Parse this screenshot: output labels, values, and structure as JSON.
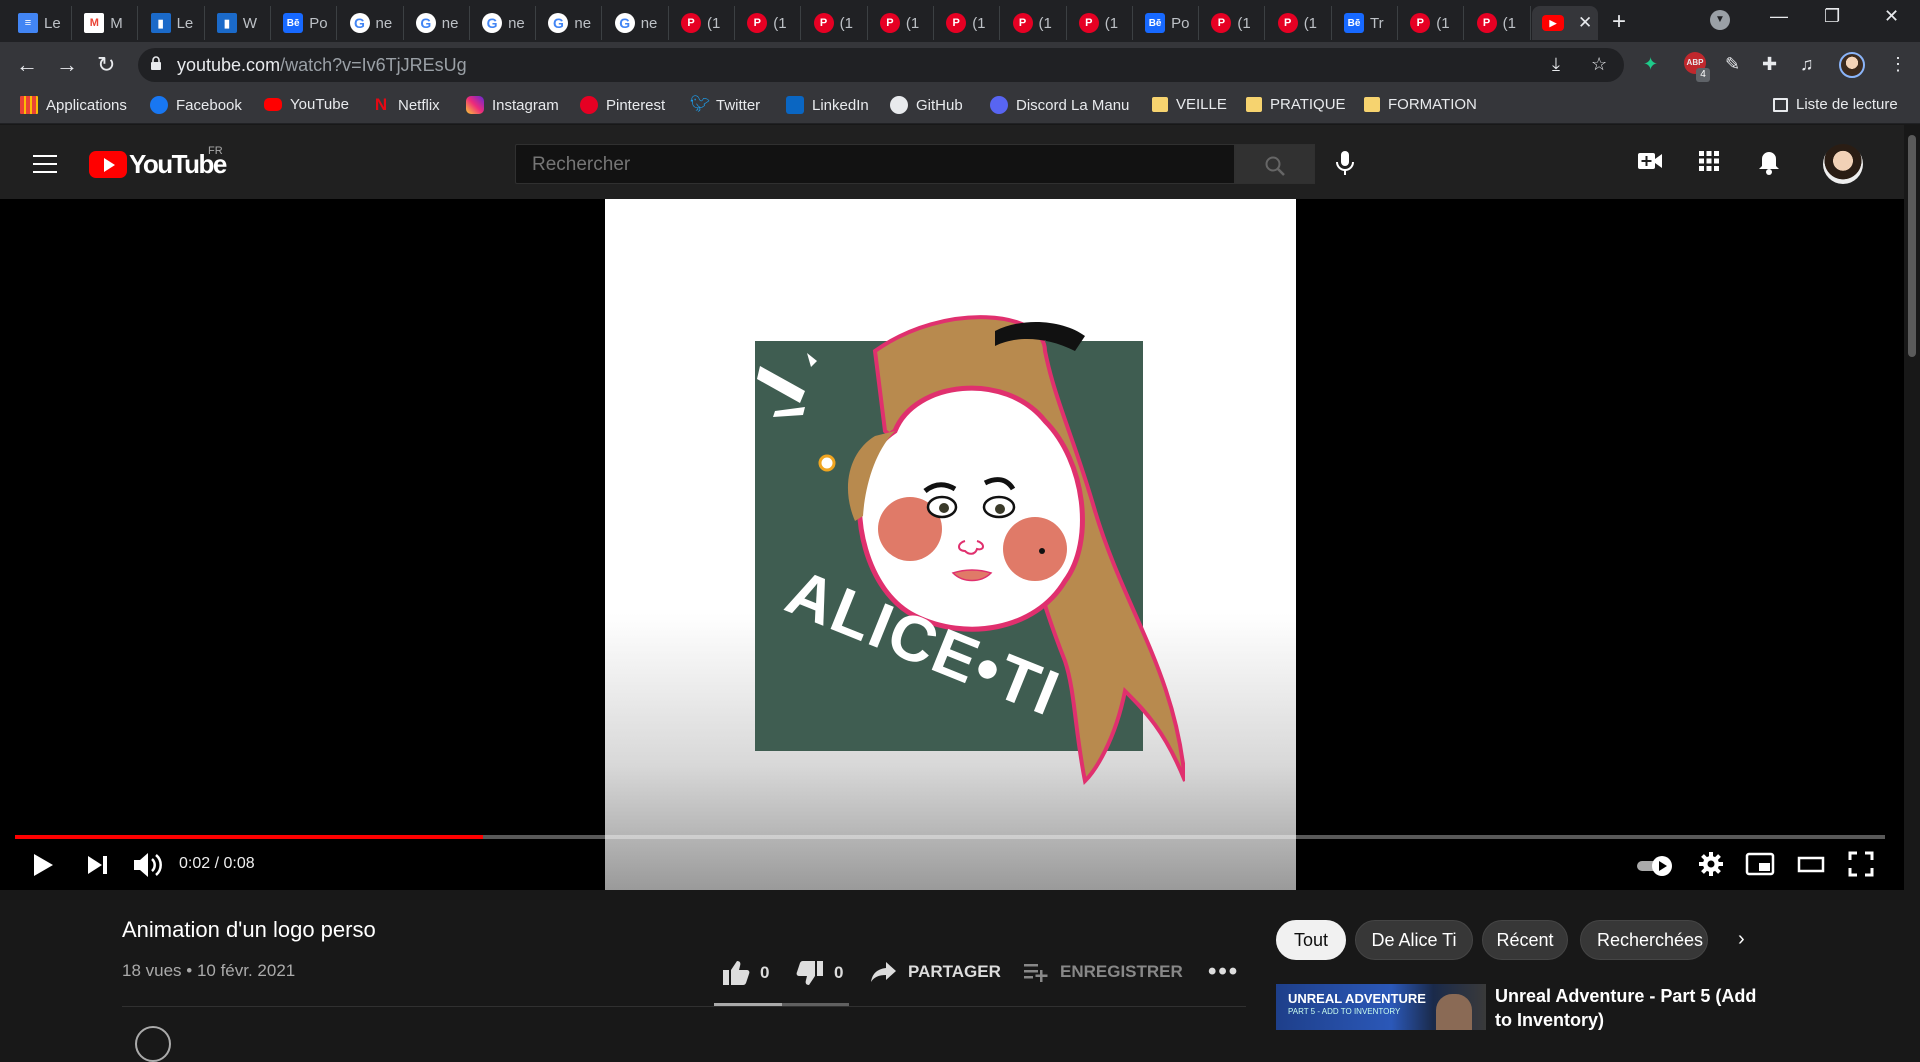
{
  "browser": {
    "tabs": [
      {
        "label": "Le",
        "icon": "docs-icon",
        "kind": "doc"
      },
      {
        "label": "M",
        "icon": "gmail-icon",
        "kind": "mail"
      },
      {
        "label": "Le",
        "icon": "webflow-icon",
        "kind": "wv"
      },
      {
        "label": "W",
        "icon": "webflow-icon",
        "kind": "wv"
      },
      {
        "label": "Po",
        "icon": "behance-icon",
        "kind": "be"
      },
      {
        "label": "ne",
        "icon": "google-icon",
        "kind": "g"
      },
      {
        "label": "ne",
        "icon": "google-icon",
        "kind": "g"
      },
      {
        "label": "ne",
        "icon": "google-icon",
        "kind": "g"
      },
      {
        "label": "ne",
        "icon": "google-icon",
        "kind": "g"
      },
      {
        "label": "ne",
        "icon": "google-icon",
        "kind": "g"
      },
      {
        "label": "(1",
        "icon": "pinterest-icon",
        "kind": "p"
      },
      {
        "label": "(1",
        "icon": "pinterest-icon",
        "kind": "p"
      },
      {
        "label": "(1",
        "icon": "pinterest-icon",
        "kind": "p"
      },
      {
        "label": "(1",
        "icon": "pinterest-icon",
        "kind": "p"
      },
      {
        "label": "(1",
        "icon": "pinterest-icon",
        "kind": "p"
      },
      {
        "label": "(1",
        "icon": "pinterest-icon",
        "kind": "p"
      },
      {
        "label": "(1",
        "icon": "pinterest-icon",
        "kind": "p"
      },
      {
        "label": "Po",
        "icon": "behance-icon",
        "kind": "be"
      },
      {
        "label": "(1",
        "icon": "pinterest-icon",
        "kind": "p"
      },
      {
        "label": "(1",
        "icon": "pinterest-icon",
        "kind": "p"
      },
      {
        "label": "Tr",
        "icon": "behance-icon",
        "kind": "be"
      },
      {
        "label": "(1",
        "icon": "pinterest-icon",
        "kind": "p"
      },
      {
        "label": "(1",
        "icon": "pinterest-icon",
        "kind": "p"
      }
    ],
    "active_tab_icon": "youtube-icon",
    "url_host": "youtube.com",
    "url_path": "/watch?v=Iv6TjJREsUg",
    "extension_badge": "4",
    "bookmarks": [
      {
        "label": "Applications",
        "icon": "apps-grid-icon",
        "cls": "grid"
      },
      {
        "label": "Facebook",
        "icon": "facebook-icon",
        "cls": "fb"
      },
      {
        "label": "YouTube",
        "icon": "youtube-icon",
        "cls": "ytb"
      },
      {
        "label": "Netflix",
        "icon": "netflix-icon",
        "cls": "nf"
      },
      {
        "label": "Instagram",
        "icon": "instagram-icon",
        "cls": "ig"
      },
      {
        "label": "Pinterest",
        "icon": "pinterest-icon",
        "cls": "pin"
      },
      {
        "label": "Twitter",
        "icon": "twitter-icon",
        "cls": "tw"
      },
      {
        "label": "LinkedIn",
        "icon": "linkedin-icon",
        "cls": "li"
      },
      {
        "label": "GitHub",
        "icon": "github-icon",
        "cls": "gh"
      },
      {
        "label": "Discord La Manu",
        "icon": "discord-icon",
        "cls": "dc"
      },
      {
        "label": "VEILLE",
        "icon": "folder-icon",
        "cls": "folder"
      },
      {
        "label": "PRATIQUE",
        "icon": "folder-icon",
        "cls": "folder"
      },
      {
        "label": "FORMATION",
        "icon": "folder-icon",
        "cls": "folder"
      }
    ],
    "reading_list": "Liste de lecture"
  },
  "youtube": {
    "logo_text": "YouTube",
    "country": "FR",
    "search_placeholder": "Rechercher",
    "player": {
      "time_current": "0:02",
      "time_total": "0:08",
      "progress_fraction": 0.25,
      "artwork_text": "ALICE•TI",
      "colors": {
        "red": "#ff0000",
        "artwork_bg": "#3f5d51",
        "hair": "#b88a4e",
        "outline": "#e0306e",
        "cheek": "#e07a68"
      }
    },
    "video": {
      "title": "Animation d'un logo perso",
      "views": "18 vues",
      "date": "10 févr. 2021",
      "likes": "0",
      "dislikes": "0",
      "share_label": "PARTAGER",
      "save_label": "ENREGISTRER"
    },
    "chips": [
      "Tout",
      "De Alice Ti",
      "Récent",
      "Recherchées r"
    ],
    "recommendation": {
      "thumb_title": "UNREAL ADVENTURE",
      "thumb_subtitle": "PART 5 - ADD TO INVENTORY",
      "title": "Unreal Adventure - Part 5 (Add to Inventory)"
    }
  }
}
